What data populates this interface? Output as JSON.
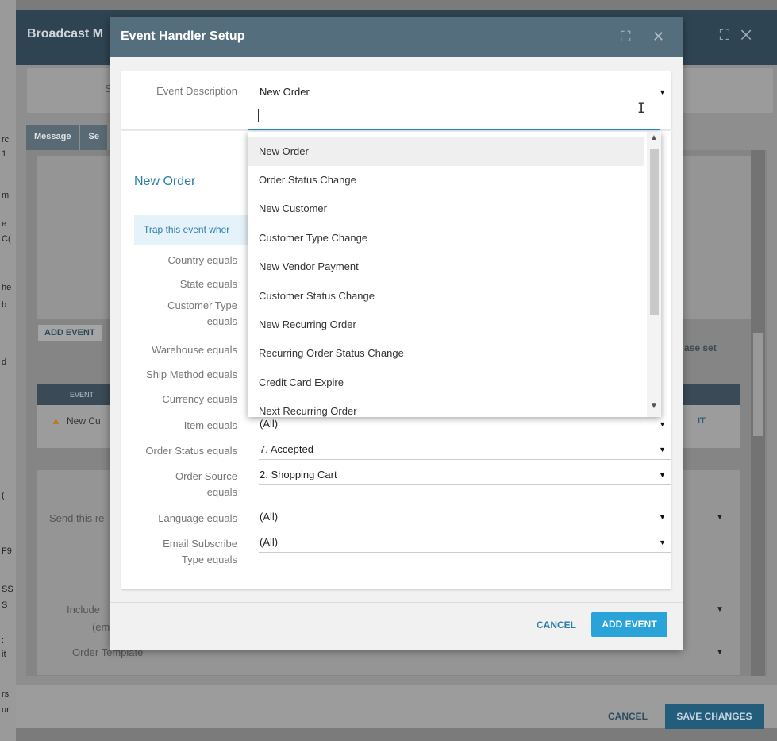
{
  "background": {
    "window_title": "Broadcast M",
    "top_panel_text": "S",
    "tabs": [
      "Message",
      "Se"
    ],
    "add_event_label": "ADD EVENT",
    "phase_set_text": "ase set",
    "table_header": "EVENT",
    "table_row_text": "New Cu",
    "edit_label": "IT",
    "send_label": "Send this re",
    "include_label": "Include",
    "include_sub": "(em",
    "order_template_label": "Order Template",
    "cancel_label": "CANCEL",
    "save_label": "SAVE CHANGES",
    "left_edge_fragments": [
      "rc",
      "1",
      "m",
      "e",
      "C(",
      "he",
      "b",
      "d",
      "(",
      "F9",
      "SS",
      "S",
      ":",
      "it",
      "rs",
      "ur"
    ]
  },
  "modal": {
    "title": "Event Handler Setup",
    "event_description": {
      "label": "Event Description",
      "value": "New Order"
    },
    "section_title": "New Order",
    "trap_text": "Trap this event wher",
    "filters": [
      {
        "label": "Country equals",
        "value": ""
      },
      {
        "label": "State equals",
        "value": ""
      },
      {
        "label": "Customer Type equals",
        "value": ""
      },
      {
        "label": "Warehouse equals",
        "value": ""
      },
      {
        "label": "Ship Method equals",
        "value": ""
      },
      {
        "label": "Currency equals",
        "value": ""
      },
      {
        "label": "Item equals",
        "value": "(All)"
      },
      {
        "label": "Order Status equals",
        "value": "7. Accepted"
      },
      {
        "label": "Order Source equals",
        "value": "2. Shopping Cart"
      },
      {
        "label": "Language equals",
        "value": "(All)"
      },
      {
        "label": "Email Subscribe Type equals",
        "value": "(All)"
      }
    ],
    "cancel_label": "CANCEL",
    "add_event_label": "ADD EVENT"
  },
  "dropdown": {
    "search_value": "",
    "options": [
      "New Order",
      "Order Status Change",
      "New Customer",
      "Customer Type Change",
      "New Vendor Payment",
      "Customer Status Change",
      "New Recurring Order",
      "Recurring Order Status Change",
      "Credit Card Expire",
      "Next Recurring Order"
    ],
    "selected_index": 0
  }
}
